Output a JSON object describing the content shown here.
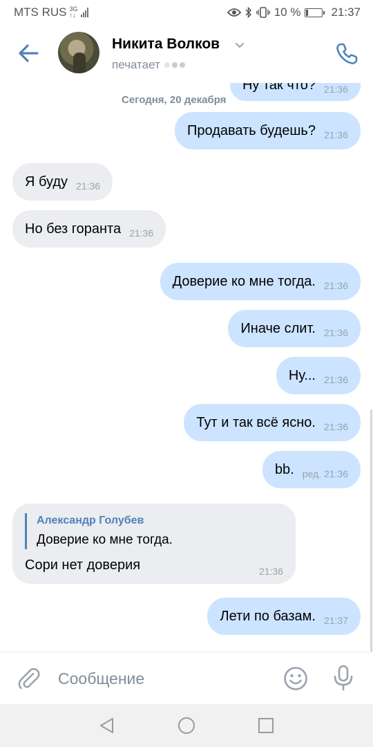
{
  "status_bar": {
    "carrier": "MTS RUS",
    "network_top": "3G",
    "network_bottom": "↑↓",
    "battery_percent": "10 %",
    "time": "21:37",
    "icons": [
      "eye-icon",
      "bluetooth-icon",
      "vibrate-icon",
      "battery-icon"
    ]
  },
  "header": {
    "contact_name": "Никита Волков",
    "status": "печатает",
    "icons": [
      "back-arrow-icon",
      "avatar",
      "chevron-down-icon",
      "phone-icon"
    ]
  },
  "chat": {
    "date_label": "Сегодня, 20 декабря",
    "partial_message": {
      "text": "Ну так что?",
      "time": "21:36"
    },
    "messages": [
      {
        "dir": "out",
        "text": "Продавать будешь?",
        "time": "21:36"
      },
      {
        "dir": "in",
        "text": "Я буду",
        "time": "21:36"
      },
      {
        "dir": "in",
        "text": "Но без горанта",
        "time": "21:36"
      },
      {
        "dir": "out",
        "text": "Доверие ко мне тогда.",
        "time": "21:36"
      },
      {
        "dir": "out",
        "text": "Иначе слит.",
        "time": "21:36"
      },
      {
        "dir": "out",
        "text": "Ну...",
        "time": "21:36"
      },
      {
        "dir": "out",
        "text": "Тут и так всё ясно.",
        "time": "21:36"
      },
      {
        "dir": "out",
        "text": "bb.",
        "time": "ред. 21:36"
      }
    ],
    "reply": {
      "author": "Александр Голубев",
      "quoted": "Доверие ко мне тогда.",
      "text": "Сори нет доверия",
      "time": "21:36"
    },
    "last_message": {
      "text": "Лети по базам.",
      "time": "21:37"
    }
  },
  "input": {
    "placeholder": "Сообщение",
    "icons": [
      "paperclip-icon",
      "emoji-icon",
      "microphone-icon"
    ]
  },
  "nav_bar": {
    "icons": [
      "nav-back-icon",
      "nav-home-icon",
      "nav-recent-icon"
    ]
  },
  "colors": {
    "accent": "#5181b8",
    "outgoing_bubble": "#cce4ff",
    "incoming_bubble": "#ebedf0",
    "secondary_text": "#818c99"
  }
}
